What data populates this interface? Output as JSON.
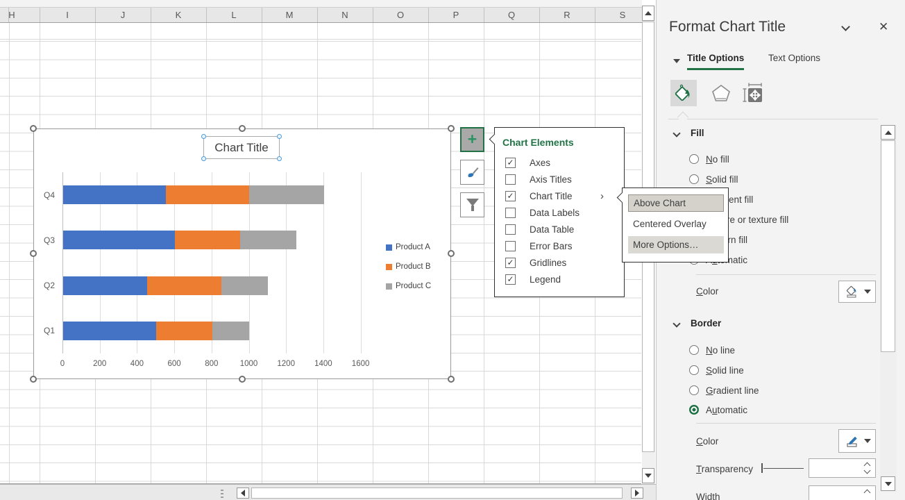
{
  "spreadsheet": {
    "columns": [
      "H",
      "I",
      "J",
      "K",
      "L",
      "M",
      "N",
      "O",
      "P",
      "Q",
      "R",
      "S"
    ]
  },
  "chart": {
    "title": "Chart Title"
  },
  "chart_data": {
    "type": "bar",
    "orientation": "horizontal",
    "stacked": true,
    "title": "Chart Title",
    "categories": [
      "Q1",
      "Q2",
      "Q3",
      "Q4"
    ],
    "series": [
      {
        "name": "Product A",
        "color": "#4472C4",
        "values": [
          500,
          450,
          600,
          550
        ]
      },
      {
        "name": "Product B",
        "color": "#ED7D31",
        "values": [
          300,
          400,
          350,
          450
        ]
      },
      {
        "name": "Product C",
        "color": "#A5A5A5",
        "values": [
          200,
          250,
          300,
          400
        ]
      }
    ],
    "xlabel": "",
    "ylabel": "",
    "x_ticks": [
      0,
      200,
      400,
      600,
      800,
      1000,
      1200,
      1400,
      1600
    ],
    "xlim": [
      0,
      1600
    ],
    "grid": true,
    "legend_position": "right"
  },
  "chart_tools": {
    "add_label": "+",
    "add_icon": "plus-icon",
    "style_icon": "brush-icon",
    "filter_icon": "funnel-icon"
  },
  "elements_menu": {
    "title": "Chart Elements",
    "items": [
      {
        "label": "Axes",
        "checked": true,
        "has_submenu": false
      },
      {
        "label": "Axis Titles",
        "checked": false,
        "has_submenu": false
      },
      {
        "label": "Chart Title",
        "checked": true,
        "has_submenu": true
      },
      {
        "label": "Data Labels",
        "checked": false,
        "has_submenu": false
      },
      {
        "label": "Data Table",
        "checked": false,
        "has_submenu": false
      },
      {
        "label": "Error Bars",
        "checked": false,
        "has_submenu": false
      },
      {
        "label": "Gridlines",
        "checked": true,
        "has_submenu": false
      },
      {
        "label": "Legend",
        "checked": true,
        "has_submenu": false
      }
    ]
  },
  "title_submenu": {
    "items": [
      {
        "label": "Above Chart",
        "state": "selected"
      },
      {
        "label": "Centered Overlay",
        "state": "normal"
      },
      {
        "label": "More Options…",
        "state": "hover"
      }
    ]
  },
  "panel": {
    "title": "Format Chart Title",
    "close_icon": "✕",
    "tabs": [
      {
        "label": "Title Options",
        "active": true
      },
      {
        "label": "Text Options",
        "active": false
      }
    ],
    "icon_tabs": [
      "fill-line-icon",
      "effects-icon",
      "size-properties-icon"
    ],
    "fill": {
      "header": "Fill",
      "options": [
        {
          "label": "No fill",
          "u": 0,
          "selected": false
        },
        {
          "label": "Solid fill",
          "u": 0,
          "selected": false
        },
        {
          "label": "Gradient fill",
          "u": 0,
          "selected": false
        },
        {
          "label": "Picture or texture fill",
          "u": 0,
          "selected": false
        },
        {
          "label": "Pattern fill",
          "u": 1,
          "selected": false
        },
        {
          "label": "Automatic",
          "u": 1,
          "selected": false
        }
      ],
      "color_label": {
        "label": "Color",
        "u": 0
      }
    },
    "border": {
      "header": "Border",
      "options": [
        {
          "label": "No line",
          "u": 0,
          "selected": false
        },
        {
          "label": "Solid line",
          "u": 0,
          "selected": false
        },
        {
          "label": "Gradient line",
          "u": 0,
          "selected": false
        },
        {
          "label": "Automatic",
          "u": 1,
          "selected": true
        }
      ],
      "color_label": {
        "label": "Color",
        "u": 0
      },
      "transparency_label": {
        "label": "Transparency",
        "u": 0
      },
      "transparency_value": "",
      "width_label": {
        "label": "Width",
        "u": 0
      },
      "width_value": ""
    },
    "accent_color": "#217346"
  }
}
